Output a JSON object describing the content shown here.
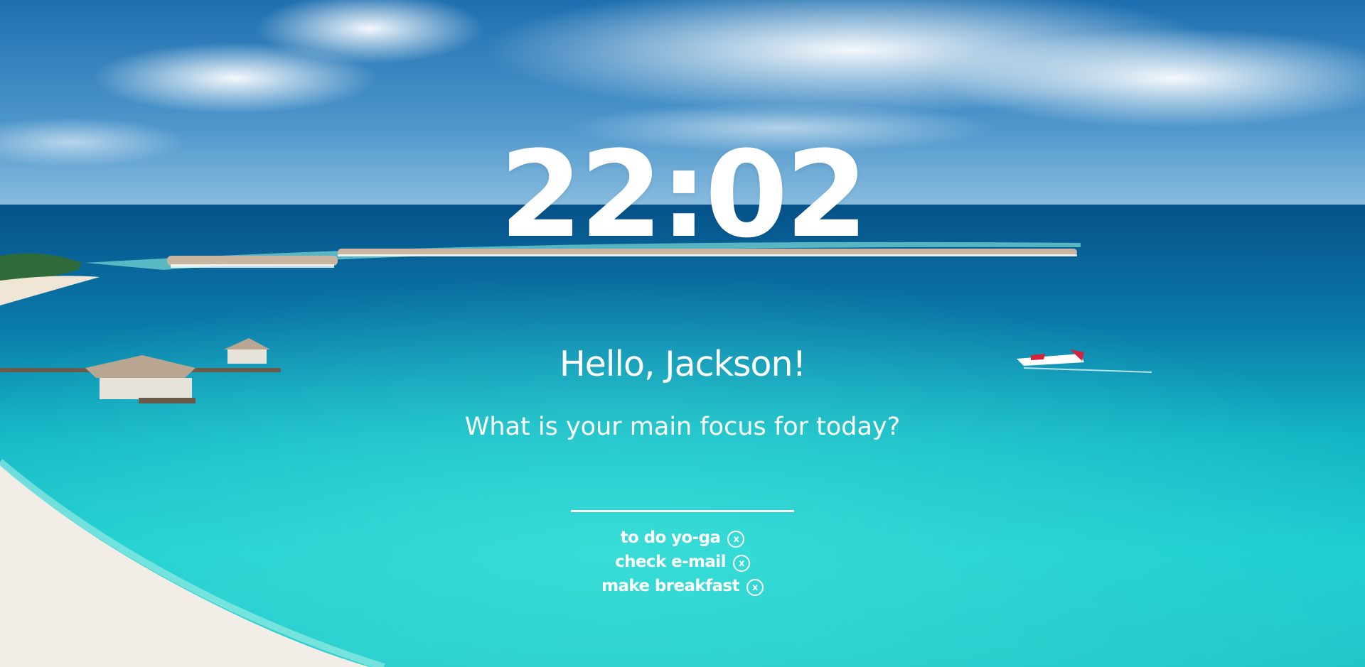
{
  "clock": {
    "time": "22:02"
  },
  "greeting": {
    "text": "Hello, Jackson!"
  },
  "focus": {
    "question": "What is your main focus for today?",
    "input_value": "",
    "placeholder": ""
  },
  "todos": [
    {
      "text": "to do yo-ga",
      "remove_label": "x"
    },
    {
      "text": "check e-mail",
      "remove_label": "x"
    },
    {
      "text": "make breakfast",
      "remove_label": "x"
    }
  ],
  "background": {
    "scene": "tropical lagoon with overwater villas, seaplane and beach",
    "colors": {
      "sky": "#2f7fbf",
      "ocean_deep": "#0a6fa8",
      "lagoon": "#19c7cf",
      "sand": "#f1ece4"
    }
  }
}
